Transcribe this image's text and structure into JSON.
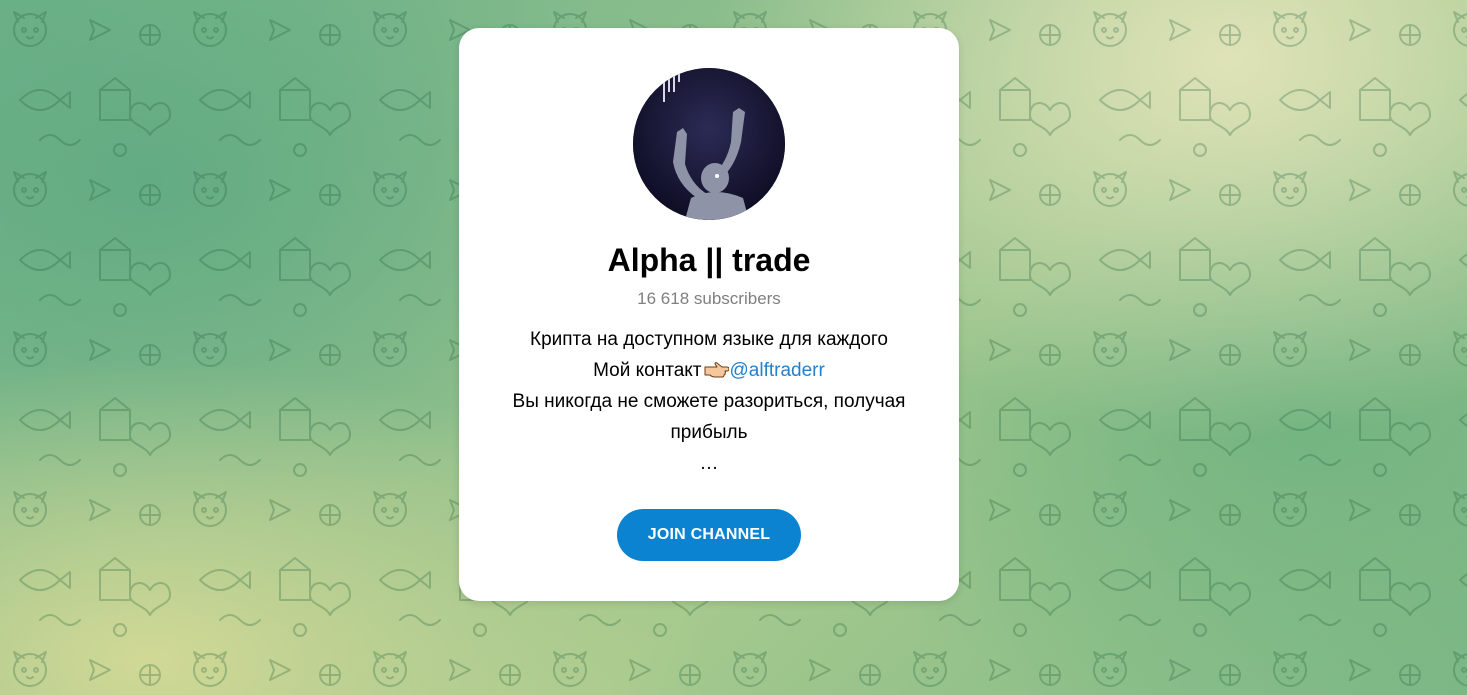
{
  "channel": {
    "title": "Alpha || trade",
    "subscribers": "16 618 subscribers",
    "description_line1": "Крипта на доступном языке для каждого",
    "description_line2_prefix": "Мой контакт",
    "contact_emoji_icon": "pointing-hand-icon",
    "contact_link": "@alftraderr",
    "description_line3": "Вы никогда не сможете разориться, получая прибыль",
    "ellipsis": "…",
    "avatar_icon": "channel-avatar"
  },
  "actions": {
    "join_label": "JOIN CHANNEL"
  },
  "colors": {
    "accent": "#0b83d0",
    "link": "#2481cc",
    "card_bg": "#ffffff",
    "muted_text": "#7f7f7f"
  }
}
